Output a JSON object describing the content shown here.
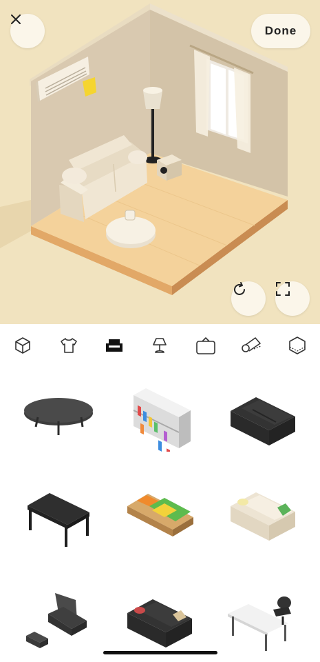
{
  "header": {
    "close_icon": "close-icon",
    "done_label": "Done"
  },
  "scene": {
    "rotate_icon": "rotate-icon",
    "fullscreen_icon": "fullscreen-icon",
    "background_color": "#f1e3bf",
    "floor_color": "#f4d29b"
  },
  "tabs": [
    {
      "name": "rooms-tab",
      "icon": "cube-icon",
      "selected": false
    },
    {
      "name": "clothing-tab",
      "icon": "shirt-icon",
      "selected": false
    },
    {
      "name": "furniture-tab",
      "icon": "sofa-icon",
      "selected": true
    },
    {
      "name": "lighting-tab",
      "icon": "lamp-icon",
      "selected": false
    },
    {
      "name": "wall-decor-tab",
      "icon": "frame-icon",
      "selected": false
    },
    {
      "name": "flooring-tab",
      "icon": "rug-roll-icon",
      "selected": false
    },
    {
      "name": "wallpaper-tab",
      "icon": "wall-pattern-icon",
      "selected": false
    }
  ],
  "items": [
    {
      "name": "oval-coffee-table-item",
      "icon": "oval-coffee-table-icon"
    },
    {
      "name": "bookshelf-item",
      "icon": "bookshelf-icon"
    },
    {
      "name": "black-sofa-item",
      "icon": "black-sofa-icon"
    },
    {
      "name": "dark-table-item",
      "icon": "dark-table-icon"
    },
    {
      "name": "bed-item",
      "icon": "bed-icon"
    },
    {
      "name": "cream-sofa-item",
      "icon": "cream-sofa-icon"
    },
    {
      "name": "armchair-ottoman-item",
      "icon": "armchair-ottoman-icon"
    },
    {
      "name": "black-sofa-cushions-item",
      "icon": "black-sofa-cushions-icon"
    },
    {
      "name": "desk-chair-item",
      "icon": "desk-chair-icon"
    }
  ]
}
